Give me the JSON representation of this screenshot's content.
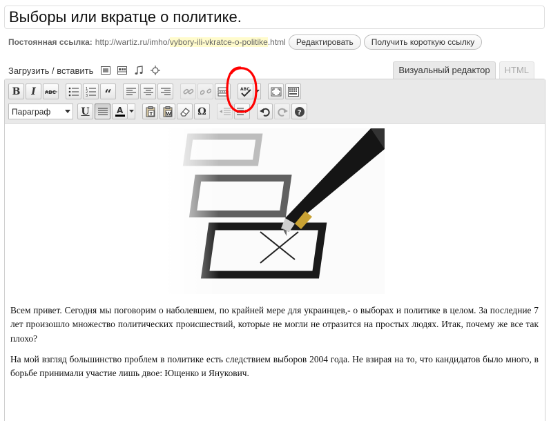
{
  "post": {
    "title": "Выборы или вкратце о политике."
  },
  "permalink": {
    "label": "Постоянная ссылка:",
    "base": "http://wartiz.ru/imho/",
    "slug": "vybory-ili-vkratce-o-politike",
    "suffix": ".html",
    "edit_button": "Редактировать",
    "shortlink_button": "Получить короткую ссылку"
  },
  "media": {
    "label": "Загрузить / вставить",
    "icons": [
      "image-icon",
      "video-icon",
      "audio-icon",
      "media-icon"
    ]
  },
  "tabs": [
    {
      "label": "Визуальный редактор",
      "active": true
    },
    {
      "label": "HTML",
      "active": false
    }
  ],
  "toolbar": {
    "format_select": "Параграф",
    "row1": [
      "bold",
      "italic",
      "strikethrough",
      "bullet-list",
      "numbered-list",
      "blockquote",
      "align-left",
      "align-center",
      "align-right",
      "link",
      "unlink",
      "more",
      "spellcheck",
      "fullscreen",
      "kitchen-sink"
    ],
    "row2": [
      "format",
      "underline",
      "justify",
      "text-color",
      "paste-text",
      "paste-word",
      "remove-format",
      "special-char",
      "outdent",
      "indent",
      "undo",
      "redo",
      "help"
    ]
  },
  "body": {
    "paragraph1": "Всем привет. Сегодня мы поговорим о наболевшем, по крайней мере для украинцев,- о выборах и политике в целом. За последние 7 лет произошло множество политических происшествий, которые не могли не отразится на простых людях. Итак, почему же все так плохо?",
    "paragraph2": "На мой взгляд большинство проблем в политике есть следствием выборов 2004 года. Не взирая на то, что кандидатов было много, в борьбе принимали участие лишь двое: Ющенко и Янукович."
  },
  "colors": {
    "annotation": "#ff0000",
    "slug_highlight": "#fffbcc",
    "toolbar_bg": "#e9e9e9"
  }
}
